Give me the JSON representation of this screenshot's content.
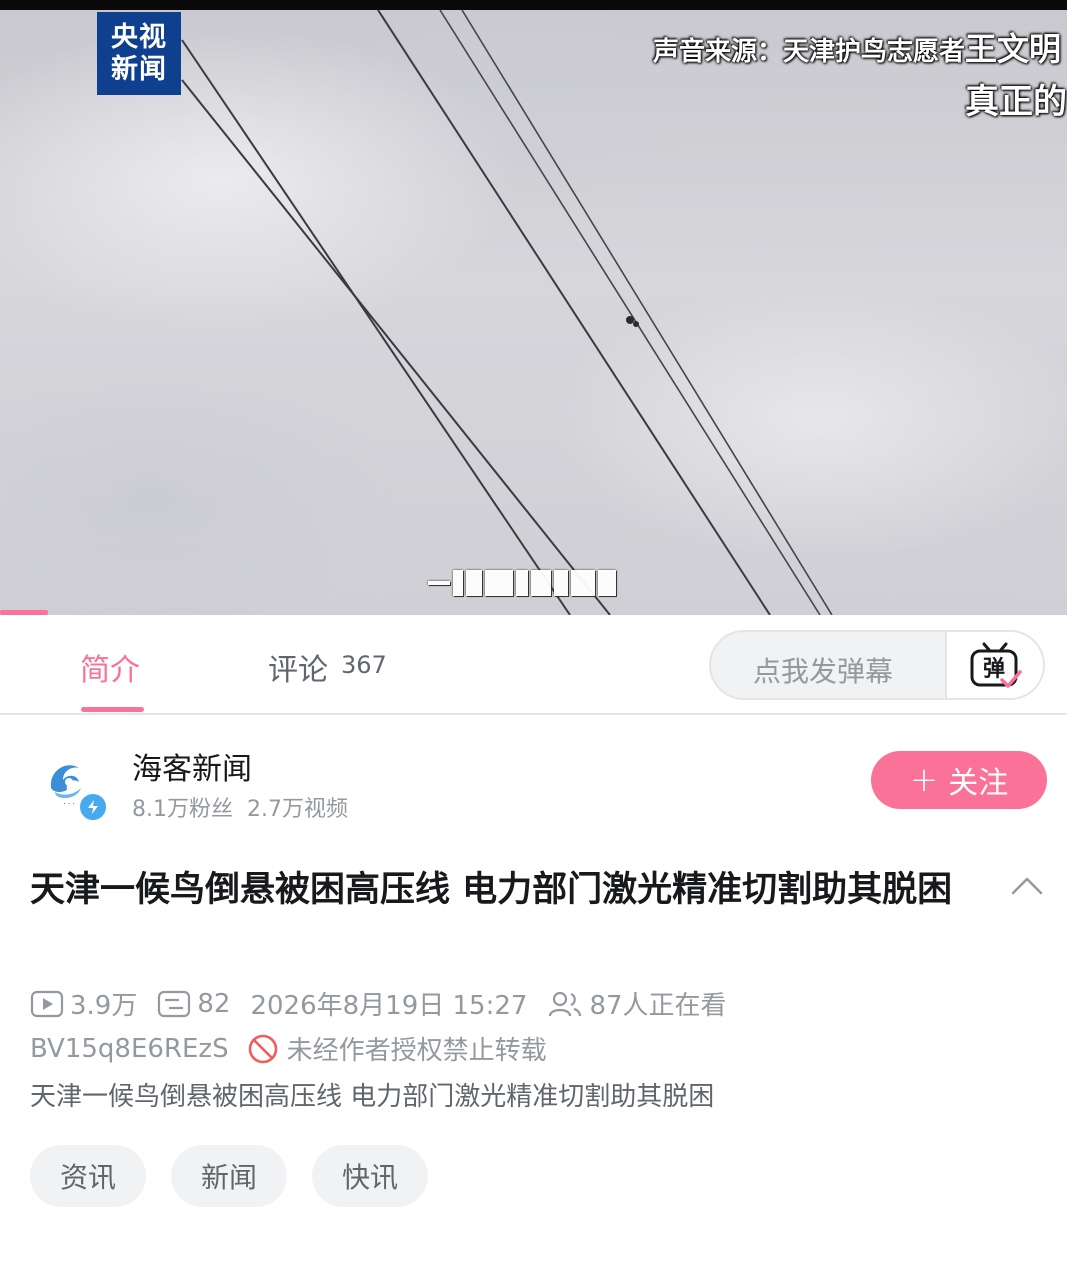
{
  "video": {
    "channel_logo": [
      "央视",
      "新闻"
    ],
    "source_caption_label": "声音来源：天津护鸟志愿者",
    "source_caption_overlap": "王文明",
    "caption_line2": "真正的"
  },
  "tabs": {
    "intro_label": "简介",
    "comments_label": "评论",
    "comments_count": "367",
    "danmaku_placeholder": "点我发弹幕",
    "danmaku_icon_char": "弹"
  },
  "author": {
    "name": "海客新闻",
    "followers": "8.1万粉丝",
    "videos": "2.7万视频",
    "follow_label": "关注",
    "follow_plus": "+"
  },
  "video_info": {
    "title": "天津一候鸟倒悬被困高压线 电力部门激光精准切割助其脱困",
    "views": "3.9万",
    "danmaku_count": "82",
    "publish_time": "2026年8月19日 15:27",
    "watching": "87人正在看",
    "bvid": "BV15q8E6REzS",
    "copyright_notice": "未经作者授权禁止转载",
    "description": "天津一候鸟倒悬被困高压线 电力部门激光精准切割助其脱困"
  },
  "tags": [
    "资讯",
    "新闻",
    "快讯"
  ],
  "colors": {
    "accent": "#fb7299",
    "secondary_text": "#9499a0",
    "logo_blue": "#0f3f8f"
  }
}
